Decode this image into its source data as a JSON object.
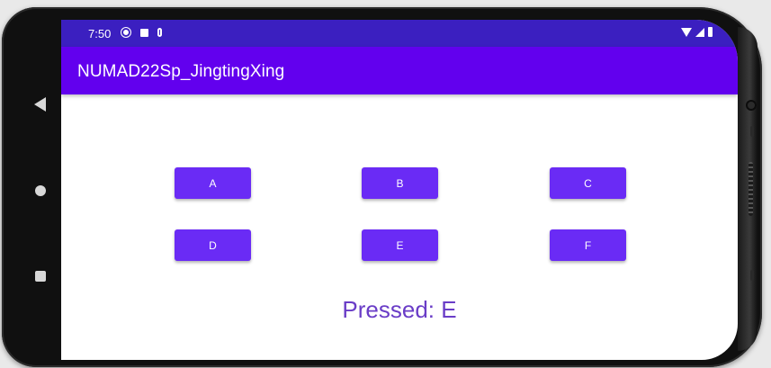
{
  "status_bar": {
    "time": "7:50",
    "left_icons": [
      "settings-icon",
      "notification-icon",
      "mic-icon"
    ],
    "right_icons": [
      "wifi-icon",
      "signal-icon",
      "battery-icon"
    ]
  },
  "app_bar": {
    "title": "NUMAD22Sp_JingtingXing"
  },
  "buttons": {
    "a": "A",
    "b": "B",
    "c": "C",
    "d": "D",
    "e": "E",
    "f": "F"
  },
  "result": {
    "text": "Pressed: E"
  },
  "nav": {
    "icons": [
      "back-icon",
      "home-icon",
      "recents-icon"
    ]
  },
  "colors": {
    "status_bar": "#3b1fc0",
    "app_bar": "#6200ee",
    "button": "#6a2bf5",
    "result_text": "#6a3dc7"
  }
}
